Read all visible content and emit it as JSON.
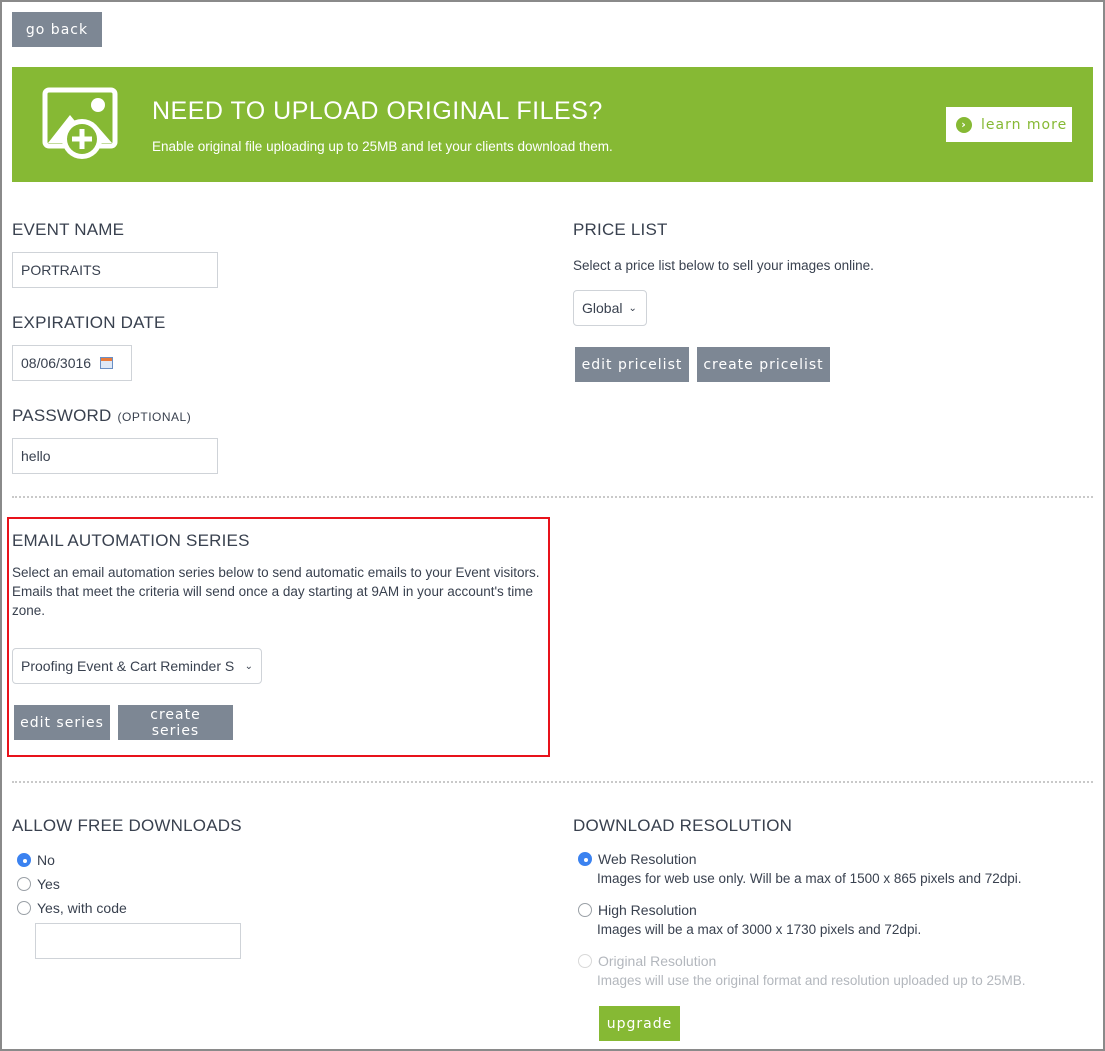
{
  "nav": {
    "go_back_label": "go back"
  },
  "banner": {
    "icon": "image-add-icon",
    "title": "NEED TO UPLOAD ORIGINAL FILES?",
    "subtitle": "Enable original file uploading up to 25MB and let your clients download them.",
    "learn_more_label": "learn more",
    "learn_more_icon": "chevron-right-circle-icon",
    "color": "#86b934"
  },
  "event_name": {
    "label": "EVENT NAME",
    "value": "PORTRAITS"
  },
  "expiration_date": {
    "label": "EXPIRATION DATE",
    "value": "08/06/3016",
    "icon": "calendar-icon"
  },
  "password": {
    "label": "PASSWORD",
    "optional_note": "(OPTIONAL)",
    "value": "hello"
  },
  "price_list": {
    "label": "PRICE LIST",
    "description": "Select a price list below to sell your images online.",
    "selected": "Global",
    "edit_label": "edit pricelist",
    "create_label": "create pricelist"
  },
  "email_automation": {
    "label": "EMAIL AUTOMATION SERIES",
    "description_1": "Select an email automation series below to send automatic emails to your Event visitors.",
    "description_2": "Emails that meet the criteria will send once a day starting at 9AM in your account's time zone.",
    "selected": "Proofing Event & Cart Reminder S",
    "edit_label": "edit series",
    "create_label": "create series",
    "highlight_color": "#e8121b"
  },
  "free_downloads": {
    "label": "ALLOW FREE DOWNLOADS",
    "options": [
      {
        "label": "No",
        "checked": true
      },
      {
        "label": "Yes",
        "checked": false
      },
      {
        "label": "Yes, with code",
        "checked": false
      }
    ],
    "code_value": ""
  },
  "download_resolution": {
    "label": "DOWNLOAD RESOLUTION",
    "options": [
      {
        "label": "Web Resolution",
        "description": "Images for web use only. Will be a max of 1500 x 865 pixels and 72dpi.",
        "checked": true,
        "disabled": false
      },
      {
        "label": "High Resolution",
        "description": "Images will be a max of 3000 x 1730 pixels and 72dpi.",
        "checked": false,
        "disabled": false
      },
      {
        "label": "Original Resolution",
        "description": "Images will use the original format and resolution uploaded up to 25MB.",
        "checked": false,
        "disabled": true
      }
    ],
    "upgrade_label": "upgrade"
  },
  "colors": {
    "button_gray": "#7d8794",
    "accent_green": "#86b934",
    "radio_blue": "#3b82f0"
  }
}
